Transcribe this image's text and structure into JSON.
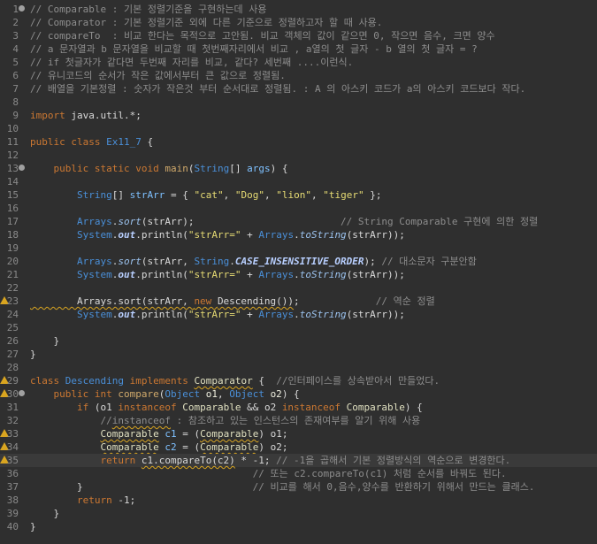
{
  "editor": {
    "lines": [
      {
        "n": "1",
        "fold": true,
        "tokens": [
          [
            "c-com",
            "// Comparable : 기본 정렬기준을 구현하는데 사용"
          ]
        ]
      },
      {
        "n": "2",
        "tokens": [
          [
            "c-com",
            "// Comparator : 기본 정렬기준 외에 다른 기준으로 정렬하고자 할 때 사용."
          ]
        ]
      },
      {
        "n": "3",
        "tokens": [
          [
            "c-com",
            "// compareTo  : 비교 한다는 목적으로 고안됨. 비교 객체의 값이 같으면 0, 작으면 음수, 크면 양수"
          ]
        ]
      },
      {
        "n": "4",
        "tokens": [
          [
            "c-com",
            "// a 문자열과 b 문자열을 비교할 때 첫번째자리에서 비교 , a열의 첫 글자 - b 열의 첫 글자 = ?"
          ]
        ]
      },
      {
        "n": "5",
        "tokens": [
          [
            "c-com",
            "// if 첫글자가 같다면 두번째 자리를 비교, 같다? 세번째 ....이런식."
          ]
        ]
      },
      {
        "n": "6",
        "tokens": [
          [
            "c-com",
            "// 유니코드의 순서가 작은 값에서부터 큰 값으로 정렬됨."
          ]
        ]
      },
      {
        "n": "7",
        "tokens": [
          [
            "c-com",
            "// 배열을 기본정렬 : 숫자가 작은것 부터 순서대로 정렬됨. : A 의 아스키 코드가 a의 아스키 코드보다 작다."
          ]
        ]
      },
      {
        "n": "8",
        "tokens": []
      },
      {
        "n": "9",
        "tokens": [
          [
            "c-kw",
            "import "
          ],
          [
            "c-plain",
            "java.util.*;"
          ]
        ]
      },
      {
        "n": "10",
        "tokens": []
      },
      {
        "n": "11",
        "tokens": [
          [
            "c-kw",
            "public class "
          ],
          [
            "c-cls",
            "Ex11_7"
          ],
          [
            "c-plain",
            " {"
          ]
        ]
      },
      {
        "n": "12",
        "tokens": []
      },
      {
        "n": "13",
        "fold": true,
        "tokens": [
          [
            "c-plain",
            "    "
          ],
          [
            "c-kw",
            "public static void "
          ],
          [
            "c-fn",
            "main"
          ],
          [
            "c-plain",
            "("
          ],
          [
            "c-cls",
            "String"
          ],
          [
            "c-plain",
            "[] "
          ],
          [
            "c-var",
            "args"
          ],
          [
            "c-plain",
            ") {"
          ]
        ]
      },
      {
        "n": "14",
        "tokens": []
      },
      {
        "n": "15",
        "tokens": [
          [
            "c-plain",
            "        "
          ],
          [
            "c-cls",
            "String"
          ],
          [
            "c-plain",
            "[] "
          ],
          [
            "c-var",
            "strArr"
          ],
          [
            "c-plain",
            " = { "
          ],
          [
            "c-str",
            "\"cat\""
          ],
          [
            "c-plain",
            ", "
          ],
          [
            "c-str",
            "\"Dog\""
          ],
          [
            "c-plain",
            ", "
          ],
          [
            "c-str",
            "\"lion\""
          ],
          [
            "c-plain",
            ", "
          ],
          [
            "c-str",
            "\"tiger\""
          ],
          [
            "c-plain",
            " };"
          ]
        ]
      },
      {
        "n": "16",
        "tokens": []
      },
      {
        "n": "17",
        "tokens": [
          [
            "c-plain",
            "        "
          ],
          [
            "c-cls",
            "Arrays"
          ],
          [
            "c-plain",
            "."
          ],
          [
            "c-static",
            "sort"
          ],
          [
            "c-plain",
            "(strArr);                         "
          ],
          [
            "c-com",
            "// String Comparable 구현에 의한 정렬"
          ]
        ]
      },
      {
        "n": "18",
        "tokens": [
          [
            "c-plain",
            "        "
          ],
          [
            "c-cls",
            "System"
          ],
          [
            "c-plain",
            "."
          ],
          [
            "c-const",
            "out"
          ],
          [
            "c-plain",
            ".println("
          ],
          [
            "c-str",
            "\"strArr=\""
          ],
          [
            "c-plain",
            " + "
          ],
          [
            "c-cls",
            "Arrays"
          ],
          [
            "c-plain",
            "."
          ],
          [
            "c-static",
            "toString"
          ],
          [
            "c-plain",
            "(strArr));"
          ]
        ]
      },
      {
        "n": "19",
        "tokens": []
      },
      {
        "n": "20",
        "tokens": [
          [
            "c-plain",
            "        "
          ],
          [
            "c-cls",
            "Arrays"
          ],
          [
            "c-plain",
            "."
          ],
          [
            "c-static",
            "sort"
          ],
          [
            "c-plain",
            "(strArr, "
          ],
          [
            "c-cls",
            "String"
          ],
          [
            "c-plain",
            "."
          ],
          [
            "c-const",
            "CASE_INSENSITIVE_ORDER"
          ],
          [
            "c-plain",
            "); "
          ],
          [
            "c-com",
            "// 대소문자 구분안함"
          ]
        ]
      },
      {
        "n": "21",
        "tokens": [
          [
            "c-plain",
            "        "
          ],
          [
            "c-cls",
            "System"
          ],
          [
            "c-plain",
            "."
          ],
          [
            "c-const",
            "out"
          ],
          [
            "c-plain",
            ".println("
          ],
          [
            "c-str",
            "\"strArr=\""
          ],
          [
            "c-plain",
            " + "
          ],
          [
            "c-cls",
            "Arrays"
          ],
          [
            "c-plain",
            "."
          ],
          [
            "c-static",
            "toString"
          ],
          [
            "c-plain",
            "(strArr));"
          ]
        ]
      },
      {
        "n": "22",
        "tokens": []
      },
      {
        "n": "23",
        "warn": true,
        "tokens": [
          [
            "c-plain ul",
            "        Arrays.sort(strArr, "
          ],
          [
            "c-kw ul",
            "new "
          ],
          [
            "c-plain ul",
            "Descending())"
          ],
          [
            "c-plain",
            ";             "
          ],
          [
            "c-com",
            "// 역순 정렬"
          ]
        ]
      },
      {
        "n": "24",
        "tokens": [
          [
            "c-plain",
            "        "
          ],
          [
            "c-cls",
            "System"
          ],
          [
            "c-plain",
            "."
          ],
          [
            "c-const",
            "out"
          ],
          [
            "c-plain",
            ".println("
          ],
          [
            "c-str",
            "\"strArr=\""
          ],
          [
            "c-plain",
            " + "
          ],
          [
            "c-cls",
            "Arrays"
          ],
          [
            "c-plain",
            "."
          ],
          [
            "c-static",
            "toString"
          ],
          [
            "c-plain",
            "(strArr));"
          ]
        ]
      },
      {
        "n": "25",
        "tokens": []
      },
      {
        "n": "26",
        "tokens": [
          [
            "c-plain",
            "    }"
          ]
        ]
      },
      {
        "n": "27",
        "tokens": [
          [
            "c-plain",
            "}"
          ]
        ]
      },
      {
        "n": "28",
        "tokens": []
      },
      {
        "n": "29",
        "warn": true,
        "tokens": [
          [
            "c-kw",
            "class "
          ],
          [
            "c-cls",
            "Descending "
          ],
          [
            "c-kw",
            "implements "
          ],
          [
            "c-type ul",
            "Comparator"
          ],
          [
            "c-plain",
            " {  "
          ],
          [
            "c-com",
            "//인터페이스를 상속받아서 만들었다."
          ]
        ]
      },
      {
        "n": "30",
        "fold": true,
        "warn": true,
        "tokens": [
          [
            "c-plain",
            "    "
          ],
          [
            "c-kw",
            "public int "
          ],
          [
            "c-fn",
            "compare"
          ],
          [
            "c-plain",
            "("
          ],
          [
            "c-cls",
            "Object "
          ],
          [
            "c-par",
            "o1"
          ],
          [
            "c-plain",
            ", "
          ],
          [
            "c-cls",
            "Object "
          ],
          [
            "c-par",
            "o2"
          ],
          [
            "c-plain",
            ") {"
          ]
        ]
      },
      {
        "n": "31",
        "tokens": [
          [
            "c-plain",
            "        "
          ],
          [
            "c-kw",
            "if "
          ],
          [
            "c-plain",
            "(o1 "
          ],
          [
            "c-kw",
            "instanceof "
          ],
          [
            "c-type",
            "Comparable"
          ],
          [
            "c-plain",
            " && o2 "
          ],
          [
            "c-kw",
            "instanceof "
          ],
          [
            "c-type",
            "Comparable"
          ],
          [
            "c-plain",
            ") {"
          ]
        ]
      },
      {
        "n": "32",
        "tokens": [
          [
            "c-plain",
            "            "
          ],
          [
            "c-com",
            "//"
          ],
          [
            "c-com ul",
            "instanceof"
          ],
          [
            "c-com",
            " : 참조하고 있는 인스턴스의 존재여부를 알기 위해 사용"
          ]
        ]
      },
      {
        "n": "33",
        "warn": true,
        "tokens": [
          [
            "c-plain",
            "            "
          ],
          [
            "c-type ul",
            "Comparable"
          ],
          [
            "c-plain",
            " "
          ],
          [
            "c-var",
            "c1"
          ],
          [
            "c-plain",
            " = ("
          ],
          [
            "c-type ul",
            "Comparable"
          ],
          [
            "c-plain",
            ") o1;"
          ]
        ]
      },
      {
        "n": "34",
        "warn": true,
        "tokens": [
          [
            "c-plain",
            "            "
          ],
          [
            "c-type ul",
            "Comparable"
          ],
          [
            "c-plain",
            " "
          ],
          [
            "c-var",
            "c2"
          ],
          [
            "c-plain",
            " = ("
          ],
          [
            "c-type ul",
            "Comparable"
          ],
          [
            "c-plain",
            ") o2;"
          ]
        ]
      },
      {
        "n": "35",
        "warn": true,
        "current": true,
        "tokens": [
          [
            "c-plain",
            "            "
          ],
          [
            "c-kw",
            "return "
          ],
          [
            "c-plain ul",
            "c1.compareTo(c2)"
          ],
          [
            "c-plain",
            " * -1; "
          ],
          [
            "c-com",
            "// -1을 곱해서 기본 정렬방식의 역순으로 변경한다."
          ]
        ]
      },
      {
        "n": "36",
        "tokens": [
          [
            "c-plain",
            "                                      "
          ],
          [
            "c-com",
            "// 또는 c2.compareTo(c1) 처럼 순서를 바꿔도 된다."
          ]
        ]
      },
      {
        "n": "37",
        "tokens": [
          [
            "c-plain",
            "        }                             "
          ],
          [
            "c-com",
            "// 비교를 해서 0,음수,양수를 반환하기 위해서 만드는 클래스."
          ]
        ]
      },
      {
        "n": "38",
        "tokens": [
          [
            "c-plain",
            "        "
          ],
          [
            "c-kw",
            "return "
          ],
          [
            "c-plain",
            "-1;"
          ]
        ]
      },
      {
        "n": "39",
        "tokens": [
          [
            "c-plain",
            "    }"
          ]
        ]
      },
      {
        "n": "40",
        "tokens": [
          [
            "c-plain",
            "}"
          ]
        ]
      }
    ]
  }
}
